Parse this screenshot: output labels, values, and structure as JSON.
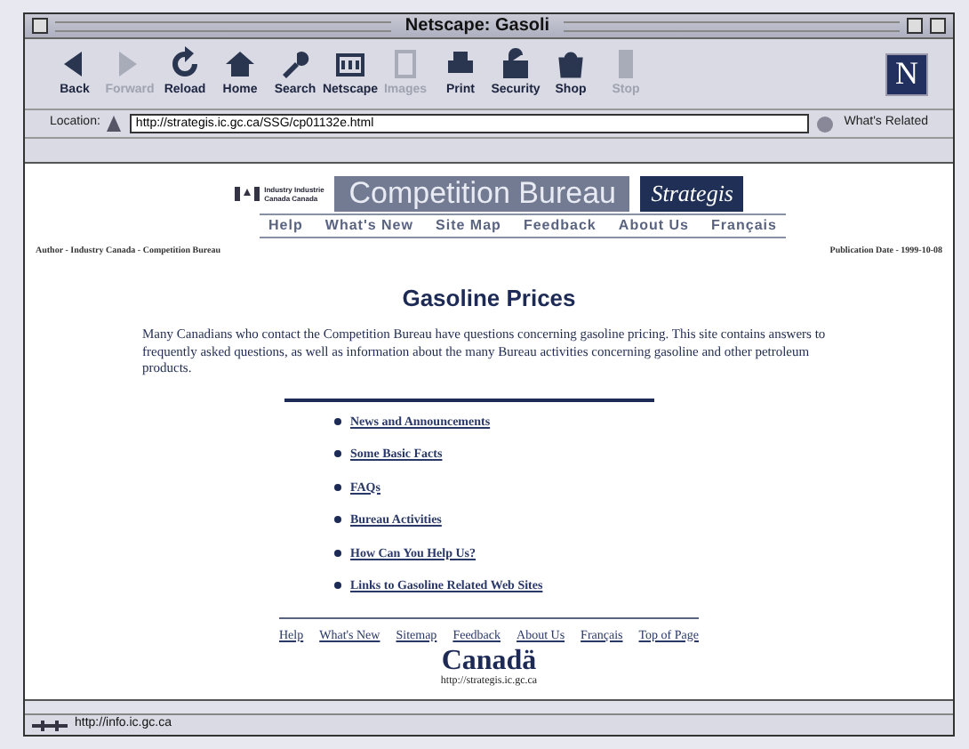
{
  "window": {
    "title": "Netscape: Gasoli"
  },
  "toolbar": [
    {
      "label": "Back",
      "disabled": false
    },
    {
      "label": "Forward",
      "disabled": true
    },
    {
      "label": "Reload",
      "disabled": false
    },
    {
      "label": "Home",
      "disabled": false
    },
    {
      "label": "Search",
      "disabled": false
    },
    {
      "label": "Netscape",
      "disabled": false
    },
    {
      "label": "Images",
      "disabled": true
    },
    {
      "label": "Print",
      "disabled": false
    },
    {
      "label": "Security",
      "disabled": false
    },
    {
      "label": "Shop",
      "disabled": false
    },
    {
      "label": "Stop",
      "disabled": true
    }
  ],
  "logo_letter": "N",
  "location": {
    "label": "Location:",
    "value": "http://strategis.ic.gc.ca/SSG/cp01132e.html",
    "related": "What's Related"
  },
  "page": {
    "header": {
      "ministry": [
        "Industry Industrie",
        "Canada Canada"
      ],
      "banner": "Competition Bureau",
      "brand": "Strategis"
    },
    "nav": [
      "Help",
      "What's New",
      "Site Map",
      "Feedback",
      "About Us",
      "Français"
    ],
    "author": "Author - Industry Canada - Competition Bureau",
    "date": "Publication Date - 1999-10-08",
    "heading": "Gasoline Prices",
    "intro": "Many Canadians who contact the Competition Bureau have questions concerning gasoline pricing. This site contains answers to frequently asked questions, as well as information about the many Bureau activities concerning gasoline and other petroleum products.",
    "links": [
      "News and Announcements",
      "Some Basic Facts",
      "FAQs",
      "Bureau Activities",
      "How Can You Help Us?",
      "Links to Gasoline Related Web Sites"
    ],
    "footer_links": [
      "Help",
      "What's New",
      "Sitemap",
      "Feedback",
      "About Us",
      "Français",
      "Top of Page"
    ],
    "wordmark": "Canadä",
    "url": "http://strategis.ic.gc.ca"
  },
  "status_bar": {
    "text": "http://info.ic.gc.ca"
  }
}
